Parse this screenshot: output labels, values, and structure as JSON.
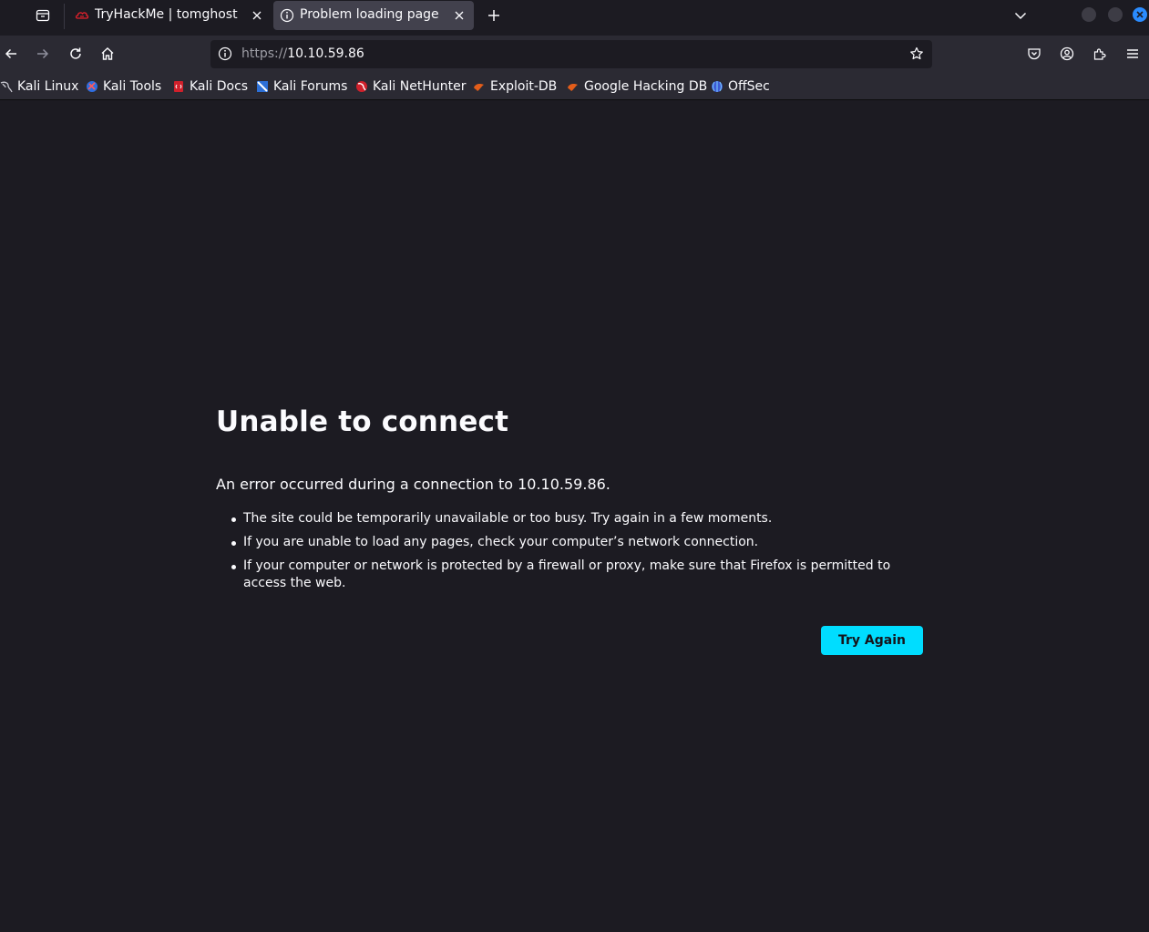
{
  "window": {
    "tabs": [
      {
        "title": "TryHackMe | tomghost",
        "active": false,
        "favicon": "tryhackme-logo-icon"
      },
      {
        "title": "Problem loading page",
        "active": true,
        "favicon": "info-icon"
      }
    ],
    "accent_color": "#2a8cff"
  },
  "navbar": {
    "url_scheme": "https://",
    "url_host": "10.10.59.86",
    "forward_enabled": false
  },
  "bookmarks": [
    {
      "label": "Kali Linux",
      "icon": "kali-dragon-icon"
    },
    {
      "label": "Kali Tools",
      "icon": "kali-tools-icon"
    },
    {
      "label": "Kali Docs",
      "icon": "kali-docs-icon"
    },
    {
      "label": "Kali Forums",
      "icon": "kali-forums-icon"
    },
    {
      "label": "Kali NetHunter",
      "icon": "kali-nethunter-icon"
    },
    {
      "label": "Exploit-DB",
      "icon": "exploit-db-icon"
    },
    {
      "label": "Google Hacking DB",
      "icon": "ghdb-icon"
    },
    {
      "label": "OffSec",
      "icon": "offsec-icon"
    }
  ],
  "error": {
    "title": "Unable to connect",
    "description": "An error occurred during a connection to 10.10.59.86.",
    "bullets": [
      "The site could be temporarily unavailable or too busy. Try again in a few moments.",
      "If you are unable to load any pages, check your computer’s network connection.",
      "If your computer or network is protected by a firewall or proxy, make sure that Firefox is permitted to access the web."
    ],
    "button_label": "Try Again",
    "button_color": "#00ddff"
  }
}
